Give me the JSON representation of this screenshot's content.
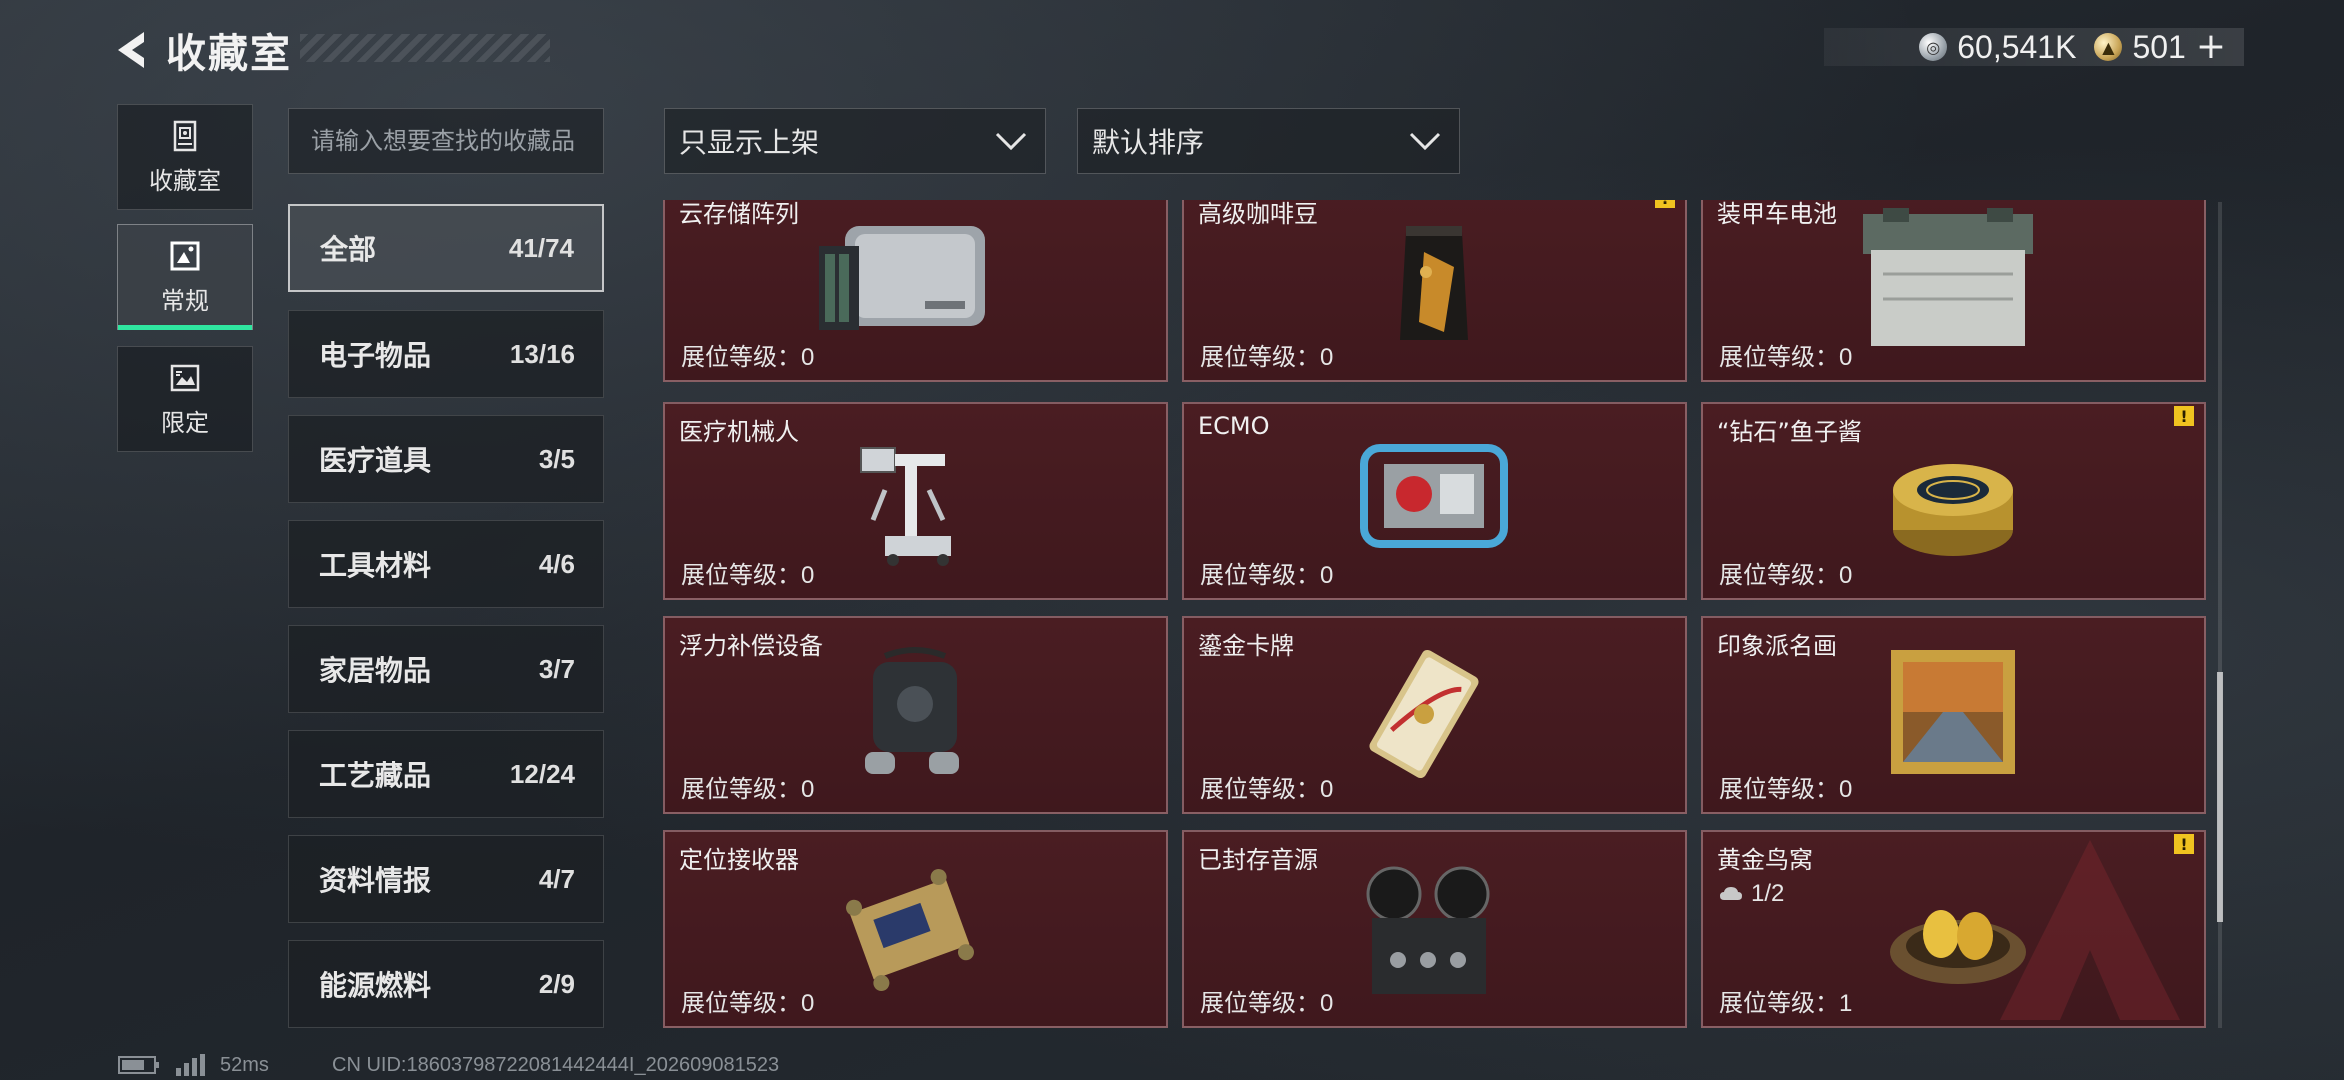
{
  "header": {
    "title": "收藏室",
    "currency": {
      "silver_amount": "60,541K",
      "gold_amount": "501",
      "add_label": "+"
    }
  },
  "side_tabs": [
    {
      "label": "收藏室",
      "icon": "vault-icon",
      "active": false
    },
    {
      "label": "常规",
      "icon": "picture-frame-icon",
      "active": true
    },
    {
      "label": "限定",
      "icon": "limited-frame-icon",
      "active": false
    }
  ],
  "search": {
    "placeholder": "请输入想要查找的收藏品",
    "value": ""
  },
  "filters": {
    "display": {
      "label": "只显示上架"
    },
    "sort": {
      "label": "默认排序"
    }
  },
  "categories": [
    {
      "name": "全部",
      "count": "41/74",
      "active": true
    },
    {
      "name": "电子物品",
      "count": "13/16",
      "active": false
    },
    {
      "name": "医疗道具",
      "count": "3/5",
      "active": false
    },
    {
      "name": "工具材料",
      "count": "4/6",
      "active": false
    },
    {
      "name": "家居物品",
      "count": "3/7",
      "active": false
    },
    {
      "name": "工艺藏品",
      "count": "12/24",
      "active": false
    },
    {
      "name": "资料情报",
      "count": "4/7",
      "active": false
    },
    {
      "name": "能源燃料",
      "count": "2/9",
      "active": false
    }
  ],
  "level_label": "展位等级：",
  "items": [
    {
      "name": "云存储阵列",
      "level": "0",
      "icon": "server-array-icon",
      "warning": false
    },
    {
      "name": "高级咖啡豆",
      "level": "0",
      "icon": "coffee-bag-icon",
      "warning": true
    },
    {
      "name": "装甲车电池",
      "level": "0",
      "icon": "battery-icon",
      "warning": false
    },
    {
      "name": "医疗机械人",
      "level": "0",
      "icon": "medical-robot-icon",
      "warning": false
    },
    {
      "name": "ECMO",
      "level": "0",
      "icon": "ecmo-machine-icon",
      "warning": false
    },
    {
      "name": "“钻石”鱼子酱",
      "level": "0",
      "icon": "caviar-tin-icon",
      "warning": true
    },
    {
      "name": "浮力补偿设备",
      "level": "0",
      "icon": "buoyancy-device-icon",
      "warning": false
    },
    {
      "name": "鎏金卡牌",
      "level": "0",
      "icon": "gilded-card-icon",
      "warning": false
    },
    {
      "name": "印象派名画",
      "level": "0",
      "icon": "framed-painting-icon",
      "warning": false
    },
    {
      "name": "定位接收器",
      "level": "0",
      "icon": "gps-receiver-icon",
      "warning": false
    },
    {
      "name": "已封存音源",
      "level": "0",
      "icon": "reel-recorder-icon",
      "warning": false
    },
    {
      "name": "黄金鸟窝",
      "level": "1",
      "icon": "golden-nest-icon",
      "warning": true,
      "progress": "1/2"
    }
  ],
  "footer": {
    "ping": "52ms",
    "uid": "CN UID:18603798722081442444I_202609081523"
  }
}
